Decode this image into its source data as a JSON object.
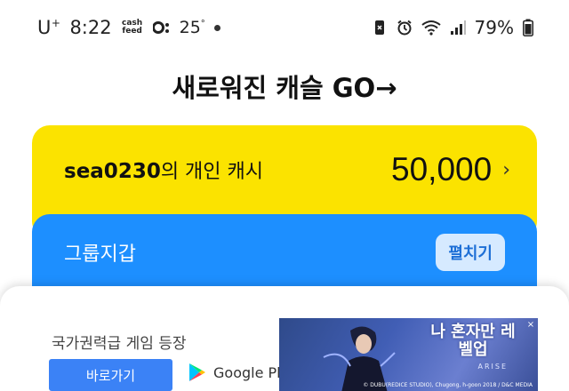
{
  "status_bar": {
    "carrier": "U",
    "carrier_sup": "+",
    "time": "8:22",
    "cashfeed_line1": "cash",
    "cashfeed_line2": "feed",
    "temperature": "25",
    "battery_percent": "79%"
  },
  "promo": {
    "label": "새로워진 캐슬 GO→"
  },
  "cash_card": {
    "user_id": "sea0230",
    "owner_suffix": "의 개인 캐시",
    "amount": "50,000",
    "chevron": "›"
  },
  "group_card": {
    "title": "그룹지갑",
    "expand_label": "펼치기"
  },
  "ad": {
    "title": "국가권력급 게임 등장",
    "cta_label": "바로가기",
    "store_label": "Google Play",
    "banner_title": "나 혼자만 레벨업",
    "banner_subtitle": "ARISE",
    "banner_credit": "© DUBU(REDICE STUDIO), Chugong, h-goon 2018 / D&C MEDIA",
    "close_glyph": "×"
  },
  "colors": {
    "cash_card_bg": "#fbe300",
    "group_card_bg": "#1d8fff",
    "cta_bg": "#3b82f6"
  }
}
